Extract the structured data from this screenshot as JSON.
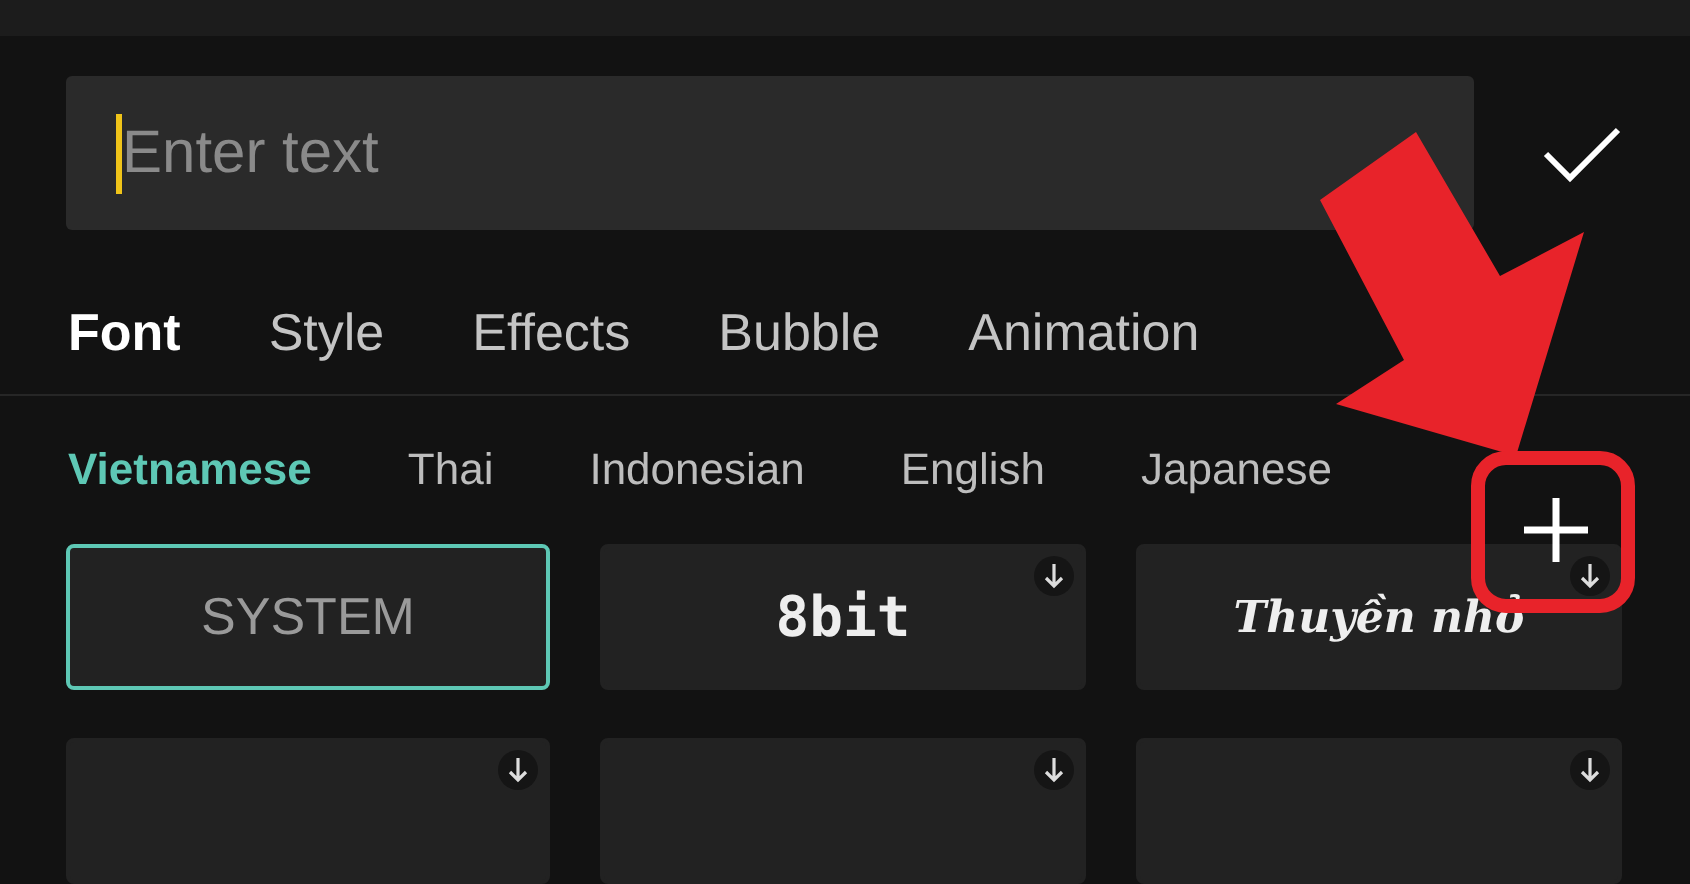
{
  "input": {
    "placeholder": "Enter text"
  },
  "tabs": [
    {
      "label": "Font",
      "selected": true
    },
    {
      "label": "Style",
      "selected": false
    },
    {
      "label": "Effects",
      "selected": false
    },
    {
      "label": "Bubble",
      "selected": false
    },
    {
      "label": "Animation",
      "selected": false
    }
  ],
  "languages": [
    {
      "label": "Vietnamese",
      "selected": true
    },
    {
      "label": "Thai",
      "selected": false
    },
    {
      "label": "Indonesian",
      "selected": false
    },
    {
      "label": "English",
      "selected": false
    },
    {
      "label": "Japanese",
      "selected": false
    }
  ],
  "fonts": [
    {
      "name": "SYSTEM",
      "kind": "system",
      "selected": true,
      "downloadable": false
    },
    {
      "name": "8bit",
      "kind": "pixel",
      "selected": false,
      "downloadable": true
    },
    {
      "name": "Thuyền nhỏ",
      "kind": "script",
      "selected": false,
      "downloadable": true
    },
    {
      "selected": false,
      "downloadable": true
    },
    {
      "selected": false,
      "downloadable": true
    },
    {
      "selected": false,
      "downloadable": true
    }
  ]
}
